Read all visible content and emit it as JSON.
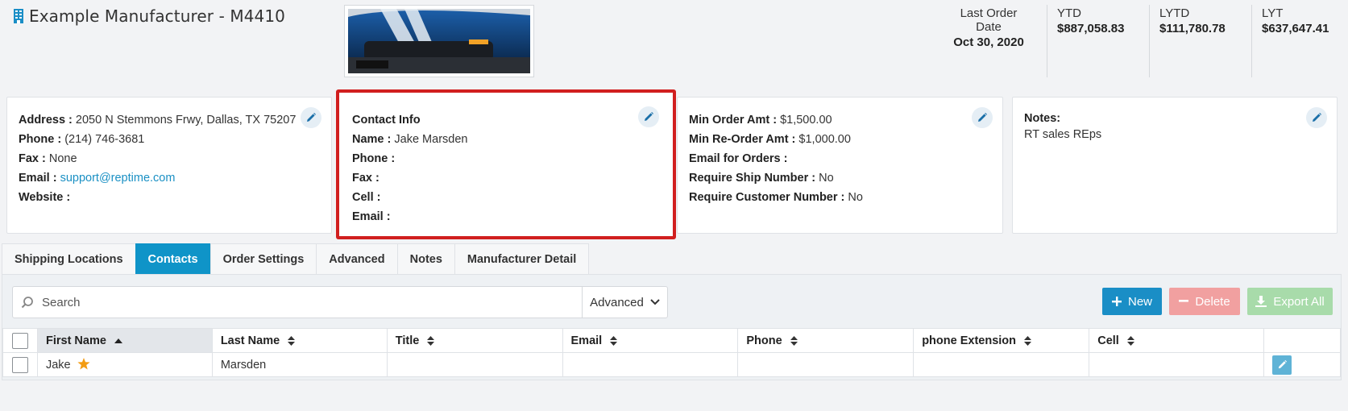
{
  "header": {
    "title": "Example Manufacturer - M4410",
    "stats": [
      {
        "label": "Last Order Date",
        "value": "Oct 30, 2020"
      },
      {
        "label": "YTD",
        "value": "$887,058.83"
      },
      {
        "label": "LYTD",
        "value": "$111,780.78"
      },
      {
        "label": "LYT",
        "value": "$637,647.41"
      }
    ]
  },
  "address_card": {
    "address_label": "Address :",
    "address": "2050 N Stemmons Frwy, Dallas, TX 75207",
    "phone_label": "Phone :",
    "phone": "(214) 746-3681",
    "fax_label": "Fax :",
    "fax": "None",
    "email_label": "Email :",
    "email": "support@reptime.com",
    "website_label": "Website :"
  },
  "contact_card": {
    "heading": "Contact Info",
    "name_label": "Name :",
    "name": "Jake Marsden",
    "phone_label": "Phone :",
    "fax_label": "Fax :",
    "cell_label": "Cell :",
    "email_label": "Email :"
  },
  "order_card": {
    "min_order_label": "Min Order Amt :",
    "min_order": "$1,500.00",
    "min_reorder_label": "Min Re-Order Amt :",
    "min_reorder": "$1,000.00",
    "email_orders_label": "Email for Orders :",
    "ship_num_label": "Require Ship Number :",
    "ship_num": "No",
    "cust_num_label": "Require Customer Number :",
    "cust_num": "No"
  },
  "notes_card": {
    "label": "Notes:",
    "text": "RT sales REps"
  },
  "tabs": [
    "Shipping Locations",
    "Contacts",
    "Order Settings",
    "Advanced",
    "Notes",
    "Manufacturer Detail"
  ],
  "toolbar": {
    "search_placeholder": "Search",
    "advanced_label": "Advanced",
    "new_label": "New",
    "delete_label": "Delete",
    "export_label": "Export All"
  },
  "table": {
    "columns": [
      "First Name",
      "Last Name",
      "Title",
      "Email",
      "Phone",
      "phone Extension",
      "Cell"
    ],
    "rows": [
      {
        "first": "Jake",
        "last": "Marsden",
        "title": "",
        "email": "",
        "phone": "",
        "ext": "",
        "cell": ""
      }
    ]
  },
  "colors": {
    "accent": "#0f94c8",
    "highlight": "#d11f1f",
    "star": "#f39c12"
  }
}
